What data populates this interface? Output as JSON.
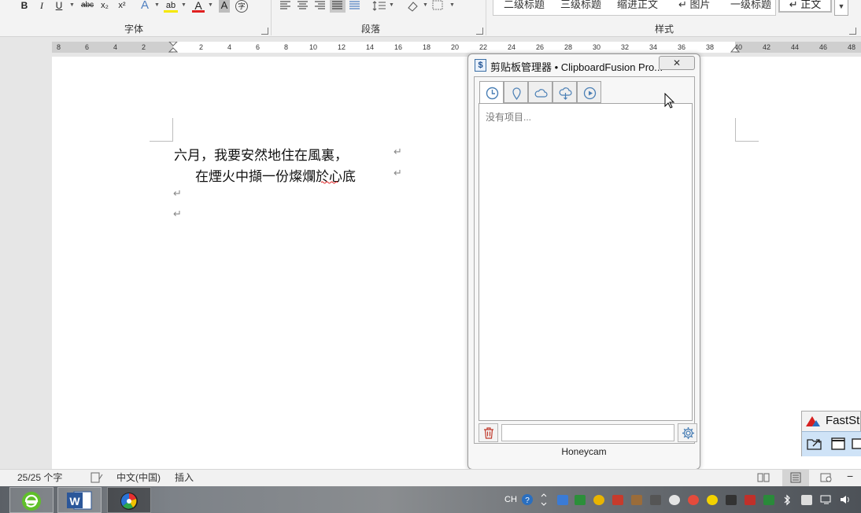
{
  "ribbon": {
    "font_group": {
      "label": "字体",
      "buttons": {
        "bold": "B",
        "italic": "I",
        "underline": "U",
        "strike": "abc",
        "subscript": "x₂",
        "superscript": "x²",
        "text_effect": "A",
        "highlight": "ab",
        "font_color": "A",
        "char_shading": "A",
        "enclose_char": "字"
      }
    },
    "paragraph_group": {
      "label": "段落"
    },
    "styles_group": {
      "label": "样式",
      "items": [
        "二级标题",
        "三级标题",
        "缩进正文",
        "↵ 图片",
        "一级标题"
      ],
      "selected": "↵ 正文"
    }
  },
  "ruler": {
    "left_labels": [
      "8",
      "6",
      "4",
      "2"
    ],
    "right_labels": [
      "2",
      "4",
      "6",
      "8",
      "10",
      "12",
      "14",
      "16",
      "18",
      "20",
      "22",
      "24",
      "26",
      "28",
      "30",
      "32",
      "34",
      "36",
      "38",
      "40",
      "42",
      "44",
      "46",
      "48"
    ]
  },
  "document": {
    "lines": [
      "六月，我要安然地住在風裏，",
      "在煙火中擷一份燦爛於心底"
    ],
    "paragraph_mark": "↵"
  },
  "status_bar": {
    "word_count": "25/25 个字",
    "language": "中文(中国)",
    "mode": "插入"
  },
  "clipboard_window": {
    "title": "剪贴板管理器 • ClipboardFusion Pro...",
    "close_label": "✕",
    "tabs": [
      {
        "name": "history",
        "icon": "clock-icon"
      },
      {
        "name": "pinned",
        "icon": "pin-icon"
      },
      {
        "name": "cloud",
        "icon": "cloud-icon"
      },
      {
        "name": "cloud-sync",
        "icon": "cloud-sync-icon"
      },
      {
        "name": "macros",
        "icon": "play-icon"
      }
    ],
    "empty_text": "没有项目...",
    "search_value": "",
    "footer": "Honeycam"
  },
  "faststone": {
    "title": "FastSt"
  },
  "taskbar": {
    "tray": {
      "input_lang": "CH"
    }
  },
  "colors": {
    "accent_blue": "#2b579a",
    "clip_icon": "#4a7fb5",
    "trash_red": "#c0392b"
  }
}
